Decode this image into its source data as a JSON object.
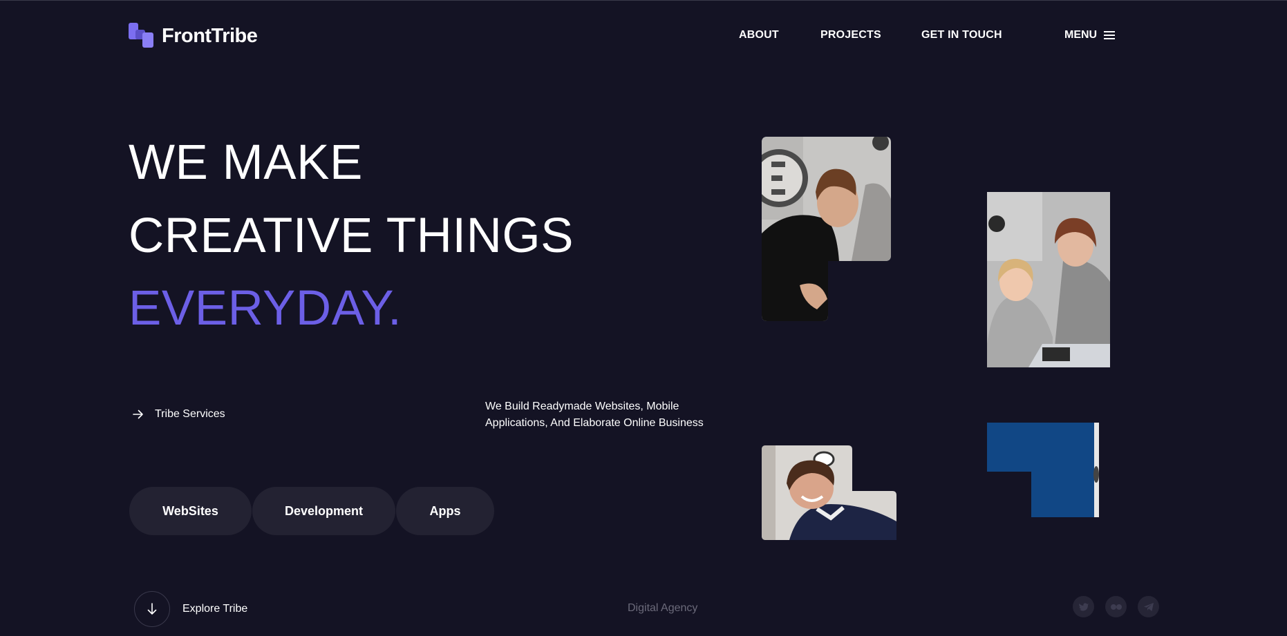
{
  "brand": {
    "name": "FrontTribe",
    "logo_icon": "fronttribe-logo-icon"
  },
  "nav": {
    "items": [
      {
        "label": "ABOUT"
      },
      {
        "label": "PROJECTS"
      },
      {
        "label": "GET IN TOUCH"
      }
    ],
    "menu_label": "MENU",
    "menu_icon": "hamburger-icon"
  },
  "hero": {
    "line1": "WE MAKE",
    "line2": "CREATIVE THINGS",
    "line3": "EVERYDAY.",
    "accent_color": "#6c5fe6"
  },
  "services": {
    "label": "Tribe Services",
    "icon": "arrow-right-icon"
  },
  "tagline": "We Build Readymade Websites, Mobile Applications, And Elaborate Online Business",
  "pills": [
    "WebSites",
    "Development",
    "Apps"
  ],
  "footer": {
    "explore_label": "Explore Tribe",
    "explore_icon": "arrow-down-icon",
    "center_text": "Digital Agency",
    "socials": [
      "twitter-icon",
      "flickr-icon",
      "telegram-icon"
    ]
  },
  "colors": {
    "background": "#141324",
    "pill": "#232232",
    "muted": "#6b6a7a"
  }
}
